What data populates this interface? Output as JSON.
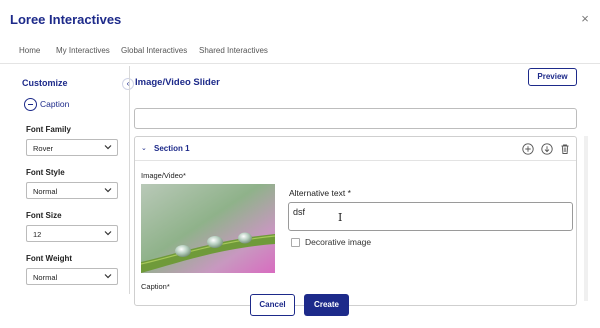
{
  "modal": {
    "title": "Loree Interactives",
    "close_glyph": "×"
  },
  "tabs": [
    {
      "label": "Home"
    },
    {
      "label": "My Interactives"
    },
    {
      "label": "Global Interactives"
    },
    {
      "label": "Shared Interactives"
    }
  ],
  "sidebar": {
    "heading": "Customize",
    "toggle_glyph": "‹",
    "caption_label": "Caption",
    "fields": [
      {
        "label": "Font Family",
        "value": "Rover"
      },
      {
        "label": "Font Style",
        "value": "Normal"
      },
      {
        "label": "Font Size",
        "value": "12"
      },
      {
        "label": "Font Weight",
        "value": "Normal"
      }
    ]
  },
  "main": {
    "title": "Image/Video Slider",
    "preview_label": "Preview",
    "title_input_value": "",
    "section": {
      "label": "Section 1",
      "chevron_glyph": "⌄",
      "media_label": "Image/Video*",
      "alt_text_label": "Alternative text *",
      "alt_text_value": "dsf",
      "decorative_label": "Decorative image",
      "decorative_checked": false,
      "caption_label": "Caption*"
    }
  },
  "footer": {
    "cancel_label": "Cancel",
    "create_label": "Create"
  },
  "colors": {
    "brand": "#1d2a8a",
    "border": "#cfcfcf",
    "text": "#222222"
  },
  "icons": {
    "add": "plus-circle-icon",
    "move_down": "arrow-down-circle-icon",
    "delete": "trash-icon",
    "select_chevron": "chevron-down-icon"
  }
}
